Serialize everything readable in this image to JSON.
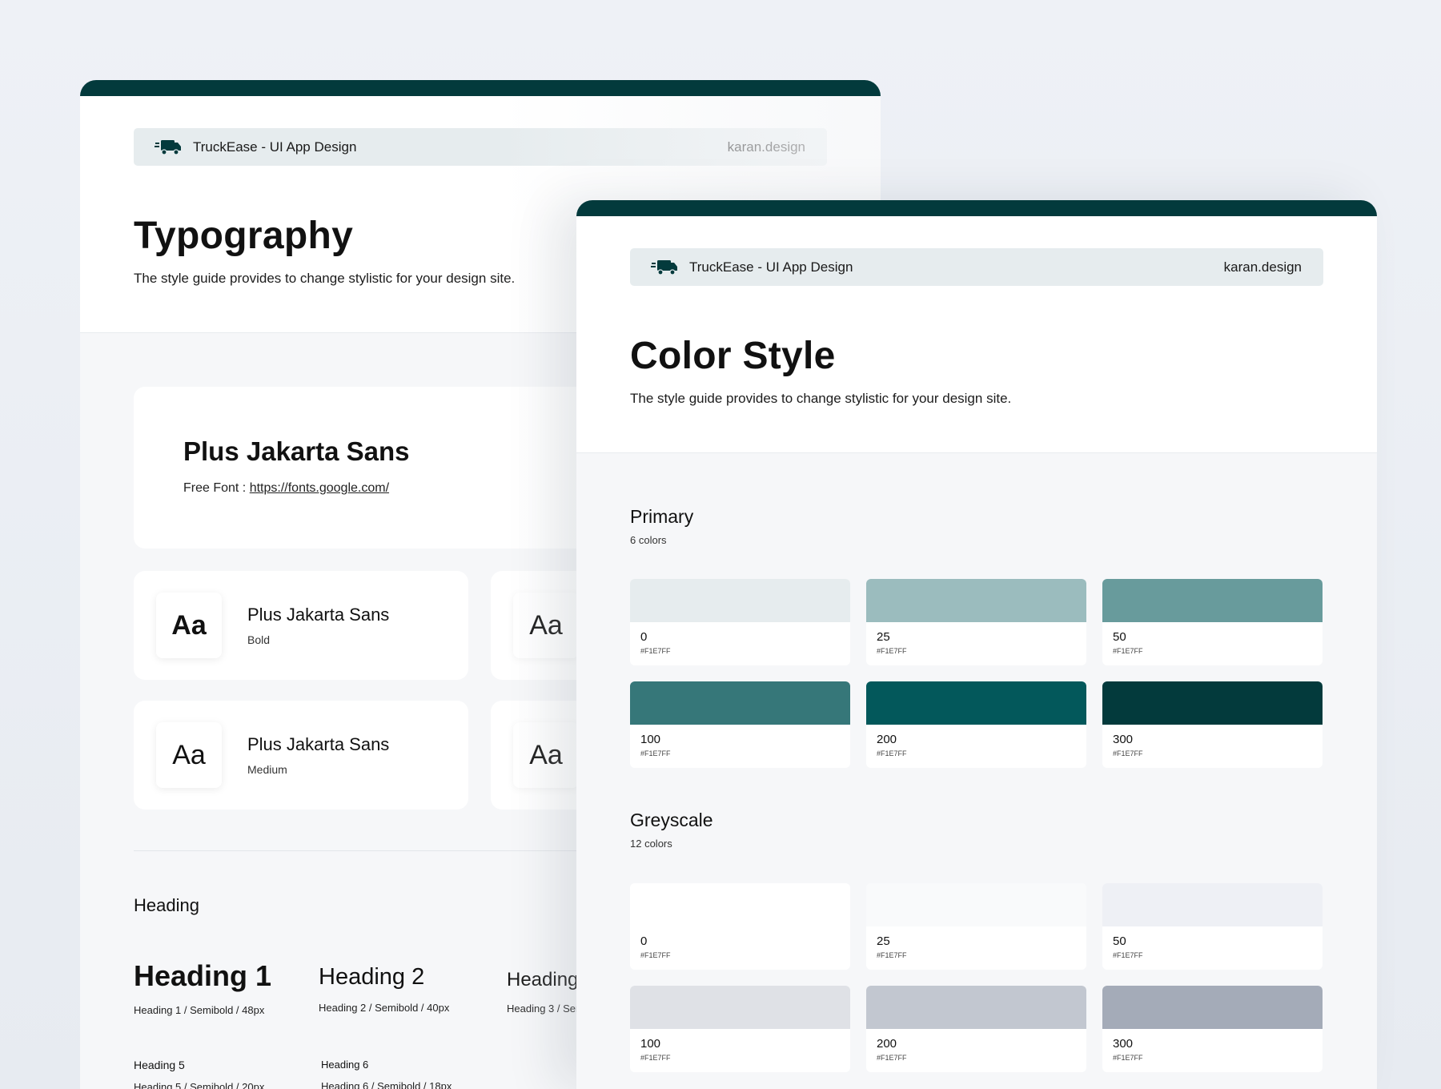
{
  "brand": {
    "app_name": "TruckEase - UI App Design",
    "site": "karan.design"
  },
  "typography": {
    "title": "Typography",
    "subtitle": "The style guide provides to change stylistic for your design site.",
    "font_card": {
      "name": "Plus Jakarta Sans",
      "free_font_label": "Free Font : ",
      "link_text": "https://fonts.google.com/"
    },
    "weights": [
      {
        "aa": "Aa",
        "name": "Plus Jakarta Sans",
        "weight": "Bold"
      },
      {
        "aa": "Aa",
        "name": "Plus Jakarta Sans",
        "weight": "Medium"
      }
    ],
    "ghost_aa": [
      "Aa",
      "Aa"
    ],
    "heading_section": "Heading",
    "headings": [
      {
        "title": "Heading 1",
        "spec": "Heading 1 / Semibold / 48px"
      },
      {
        "title": "Heading 2",
        "spec": "Heading 2 / Semibold / 40px"
      },
      {
        "title": "Heading",
        "spec": "Heading 3 / Ser"
      },
      {
        "title": "Heading 5",
        "spec": "Heading 5 / Semibold / 20px"
      },
      {
        "title": "Heading 6",
        "spec": "Heading 6 / Semibold / 18px"
      }
    ]
  },
  "color_style": {
    "title": "Color Style",
    "subtitle": "The style guide provides to change stylistic for your design site.",
    "primary": {
      "title": "Primary",
      "count": "6 colors",
      "swatches": [
        {
          "label": "0",
          "hex": "#F1E7FF",
          "color": "#e6ecee"
        },
        {
          "label": "25",
          "hex": "#F1E7FF",
          "color": "#9bbcbe"
        },
        {
          "label": "50",
          "hex": "#F1E7FF",
          "color": "#689b9c"
        },
        {
          "label": "100",
          "hex": "#F1E7FF",
          "color": "#367779"
        },
        {
          "label": "200",
          "hex": "#F1E7FF",
          "color": "#03585b"
        },
        {
          "label": "300",
          "hex": "#F1E7FF",
          "color": "#033a3c"
        }
      ]
    },
    "greyscale": {
      "title": "Greyscale",
      "count": "12 colors",
      "swatches": [
        {
          "label": "0",
          "hex": "#F1E7FF",
          "color": "#ffffff"
        },
        {
          "label": "25",
          "hex": "#F1E7FF",
          "color": "#f9fafb"
        },
        {
          "label": "50",
          "hex": "#F1E7FF",
          "color": "#eef0f5"
        },
        {
          "label": "100",
          "hex": "#F1E7FF",
          "color": "#dfe1e6"
        },
        {
          "label": "200",
          "hex": "#F1E7FF",
          "color": "#c2c7d0"
        },
        {
          "label": "300",
          "hex": "#F1E7FF",
          "color": "#a4abb8"
        }
      ]
    }
  }
}
